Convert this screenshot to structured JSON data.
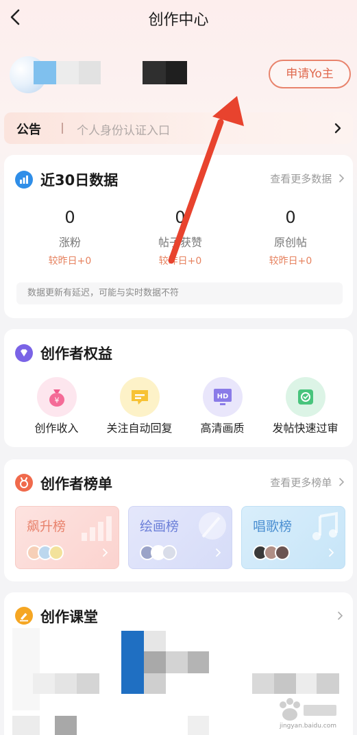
{
  "header": {
    "title": "创作中心"
  },
  "profile": {
    "apply_label": "申请Yo主"
  },
  "notice": {
    "label": "公告",
    "text": "个人身份认证入口"
  },
  "data_card": {
    "title": "近30日数据",
    "more": "查看更多数据",
    "stats": [
      {
        "value": "0",
        "label": "涨粉",
        "delta": "较昨日+0"
      },
      {
        "value": "0",
        "label": "帖子获赞",
        "delta": "较昨日+0"
      },
      {
        "value": "0",
        "label": "原创帖",
        "delta": "较昨日+0"
      }
    ],
    "note": "数据更新有延迟，可能与实时数据不符"
  },
  "benefits_card": {
    "title": "创作者权益",
    "items": [
      {
        "label": "创作收入",
        "icon": "money-bag-icon"
      },
      {
        "label": "关注自动回复",
        "icon": "chat-bubble-icon"
      },
      {
        "label": "高清画质",
        "icon": "hd-monitor-icon"
      },
      {
        "label": "发帖快速过审",
        "icon": "approved-badge-icon"
      }
    ]
  },
  "ranking_card": {
    "title": "创作者榜单",
    "more": "查看更多榜单",
    "ranks": [
      {
        "name": "飙升榜",
        "color": "#e8826c"
      },
      {
        "name": "绘画榜",
        "color": "#6b7fd8"
      },
      {
        "name": "唱歌榜",
        "color": "#4b8fd1"
      }
    ]
  },
  "class_card": {
    "title": "创作课堂"
  },
  "watermark": {
    "text": "jingyan.baidu.com"
  },
  "colors": {
    "accent": "#e06a4f",
    "annotation_arrow": "#e8432e",
    "data_icon": "#2f8ee8",
    "benefit_icon": "#7a63e6",
    "ranking_icon": "#f06a4c",
    "class_icon": "#f5a623"
  }
}
